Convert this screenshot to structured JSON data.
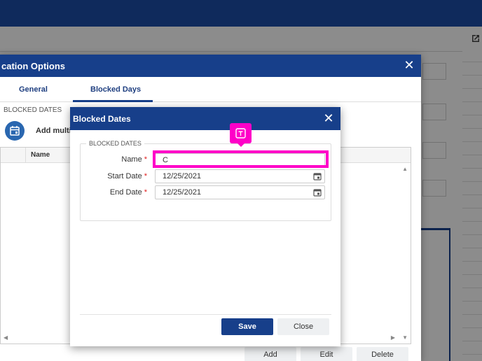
{
  "outer_dialog": {
    "title": "cation Options",
    "tabs": [
      {
        "label": "General"
      },
      {
        "label": "Blocked Days"
      }
    ],
    "section_label": "BLOCKED DATES",
    "add_multiple": "Add multi",
    "grid": {
      "columns": [
        {
          "label": "Name"
        }
      ]
    },
    "buttons": {
      "add": "Add",
      "edit": "Edit",
      "delete": "Delete"
    }
  },
  "inner_dialog": {
    "title": "Blocked Dates",
    "legend": "BLOCKED DATES",
    "fields": {
      "name": {
        "label": "Name",
        "value": "C",
        "required": true
      },
      "start_date": {
        "label": "Start Date",
        "value": "12/25/2021",
        "required": true
      },
      "end_date": {
        "label": "End Date",
        "value": "12/25/2021",
        "required": true
      }
    },
    "buttons": {
      "save": "Save",
      "close": "Close"
    }
  },
  "colors": {
    "accent": "#173f8a",
    "highlight": "#ff00c8",
    "required": "#e02020"
  },
  "icons": {
    "close": "close-icon",
    "calendar": "calendar-icon",
    "calendar_add": "calendar-add-icon",
    "text_cursor_tag": "text-field-icon",
    "external_link": "external-link-icon"
  }
}
